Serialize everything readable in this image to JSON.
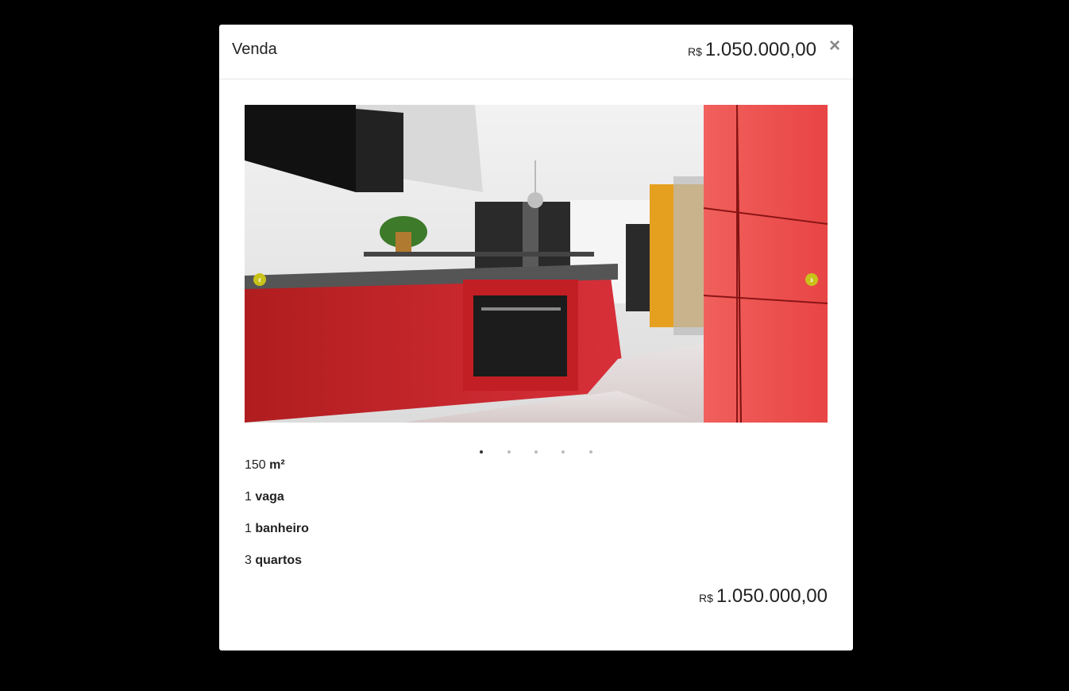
{
  "modal": {
    "title": "Venda",
    "close_label": "×",
    "header_price": {
      "currency": "R$",
      "amount": "1.050.000,00"
    }
  },
  "carousel": {
    "prev_icon": "chevron-left-icon",
    "next_icon": "chevron-right-icon",
    "prev_glyph": "‹",
    "next_glyph": "›",
    "slide_count": 5,
    "active_index": 0,
    "accent_color": "#c9c21a"
  },
  "features": [
    {
      "value": "150",
      "label": "m²"
    },
    {
      "value": "1",
      "label": "vaga"
    },
    {
      "value": "1",
      "label": "banheiro"
    },
    {
      "value": "3",
      "label": "quartos"
    }
  ],
  "footer_price": {
    "currency": "R$",
    "amount": "1.050.000,00"
  }
}
